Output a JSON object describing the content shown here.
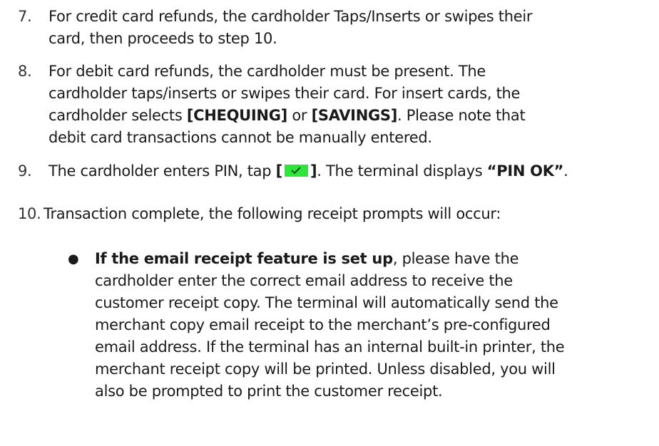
{
  "steps": [
    {
      "number": "7.",
      "lines": [
        "For credit card refunds, the cardholder Taps/Inserts or swipes their",
        "card, then proceeds to step 10."
      ]
    },
    {
      "number": "8.",
      "line1": "For debit card refunds, the cardholder must be present. The",
      "line2": "cardholder taps/inserts or swipes their card. For insert cards, the",
      "line3_pre": "cardholder selects ",
      "line3_bold1": "[CHEQUING]",
      "line3_mid": " or ",
      "line3_bold2": "[SAVINGS]",
      "line3_post": ". Please note that",
      "line4": "debit card transactions cannot be manually entered."
    },
    {
      "number": "9.",
      "pre": "The cardholder enters PIN, tap ",
      "bracket_open": "[",
      "bracket_close": "]",
      "mid": ".  The terminal displays ",
      "bold": "“PIN OK”",
      "post": "."
    },
    {
      "number": "10.",
      "text": "Transaction complete, the following receipt prompts will occur:"
    }
  ],
  "bullet": {
    "symbol": "●",
    "bold_lead": "If the email receipt feature is set up",
    "lines": [
      ", please have the",
      "cardholder enter the correct email address to receive the",
      "customer receipt copy.  The terminal will automatically send the",
      "merchant copy email receipt to the merchant’s pre-configured",
      "email address. If the terminal has an internal built-in printer, the",
      "merchant receipt copy will be printed. Unless disabled, you will",
      "also be prompted to print the customer receipt."
    ]
  },
  "icons": {
    "confirm_button": "checkmark-icon",
    "confirm_color": "#2ee53a"
  }
}
